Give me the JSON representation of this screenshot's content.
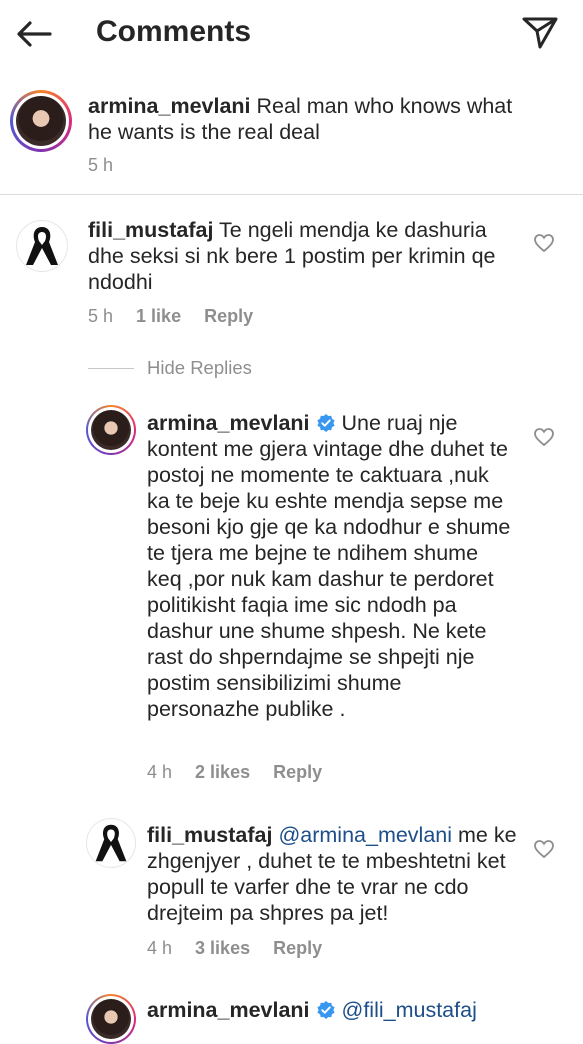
{
  "header": {
    "title": "Comments"
  },
  "caption": {
    "username": "armina_mevlani",
    "text": " Real man who knows what he wants is the real deal",
    "time": "5 h"
  },
  "comments": [
    {
      "username": "fili_mustafaj",
      "text": " Te ngeli mendja ke dashuria dhe seksi si nk bere 1 postim per krimin qe ndodhi",
      "time": "5 h",
      "likes": "1 like",
      "reply": "Reply"
    }
  ],
  "hide_replies": "Hide Replies",
  "replies": [
    {
      "username": "armina_mevlani",
      "text": " Une ruaj nje kontent me gjera vintage dhe duhet te postoj ne momente te caktuara ,nuk ka te beje ku eshte mendja sepse me besoni kjo gje qe ka ndodhur e shume te tjera me bejne te ndihem shume keq ,por nuk kam dashur te perdoret politikisht faqia ime sic ndodh pa dashur une shume shpesh. Ne kete rast do shperndajme se shpejti nje postim sensibilizimi shume personazhe publike .",
      "time": "4 h",
      "likes": "2 likes",
      "reply": "Reply"
    },
    {
      "username": "fili_mustafaj",
      "mention": "@armina_mevlani",
      "text": " me ke zhgenjyer , duhet te te mbeshtetni ket popull te varfer dhe te vrar ne cdo drejteim pa shpres pa jet!",
      "time": "4 h",
      "likes": "3 likes",
      "reply": "Reply"
    },
    {
      "username": "armina_mevlani",
      "mention": "@fili_mustafaj"
    }
  ],
  "icons": {
    "back": "arrow-left-icon",
    "send": "paper-plane-icon",
    "heart": "heart-outline-icon",
    "verified": "verified-badge-icon",
    "ribbon": "black-ribbon-icon"
  },
  "colors": {
    "verified": "#3897f0",
    "mention": "#1d4e89",
    "muted": "#8e8e8e"
  }
}
